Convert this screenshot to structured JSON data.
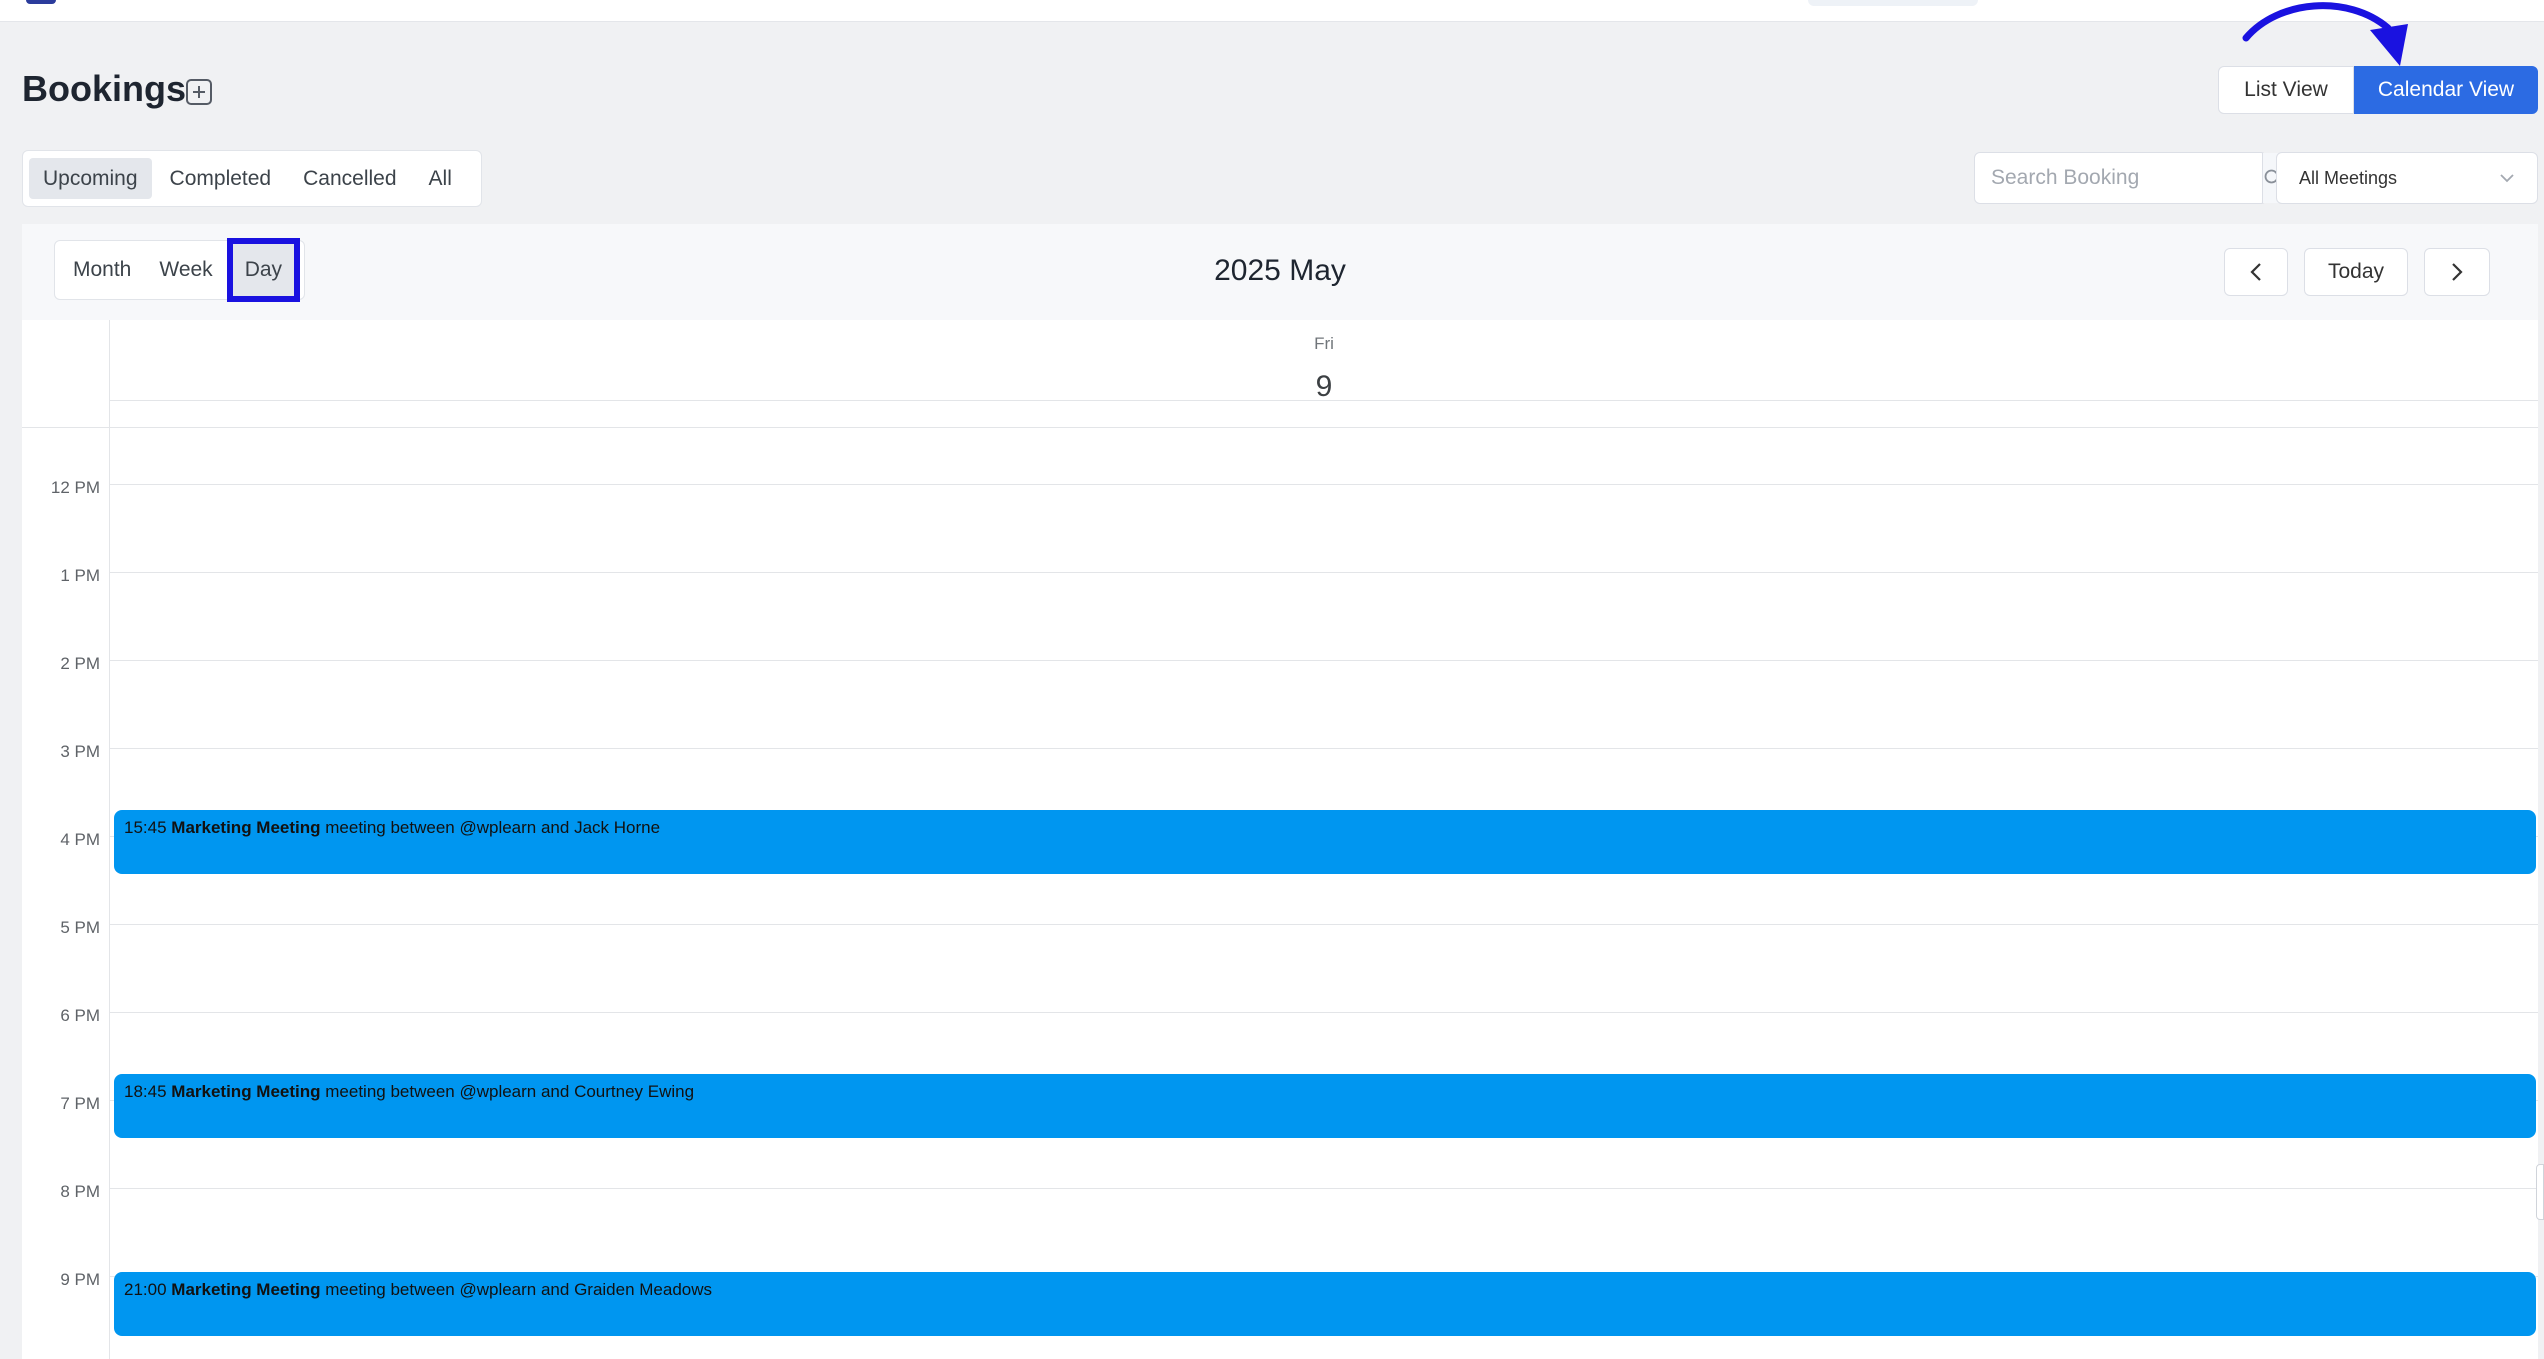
{
  "page": {
    "title": "Bookings"
  },
  "view_toggle": {
    "list_label": "List View",
    "calendar_label": "Calendar View",
    "active": "Calendar View"
  },
  "status_tabs": [
    {
      "label": "Upcoming",
      "active": true
    },
    {
      "label": "Completed",
      "active": false
    },
    {
      "label": "Cancelled",
      "active": false
    },
    {
      "label": "All",
      "active": false
    }
  ],
  "search": {
    "placeholder": "Search Booking",
    "icon": "search-icon"
  },
  "meeting_filter": {
    "selected": "All Meetings"
  },
  "calendar": {
    "modes": [
      {
        "label": "Month",
        "active": false
      },
      {
        "label": "Week",
        "active": false
      },
      {
        "label": "Day",
        "active": true
      }
    ],
    "title": "2025 May",
    "today_label": "Today",
    "day": {
      "name": "Fri",
      "number": "9"
    },
    "hours": [
      "12 PM",
      "1 PM",
      "2 PM",
      "3 PM",
      "4 PM",
      "5 PM",
      "6 PM",
      "7 PM",
      "8 PM",
      "9 PM"
    ],
    "events": [
      {
        "time": "15:45",
        "title": "Marketing Meeting",
        "description": "meeting between @wplearn and Jack Horne"
      },
      {
        "time": "18:45",
        "title": "Marketing Meeting",
        "description": "meeting between @wplearn and Courtney Ewing"
      },
      {
        "time": "21:00",
        "title": "Marketing Meeting",
        "description": "meeting between @wplearn and Graiden Meadows"
      }
    ]
  },
  "colors": {
    "accent": "#2c6be3",
    "event": "#0096f0",
    "highlight": "#1a12e0"
  }
}
